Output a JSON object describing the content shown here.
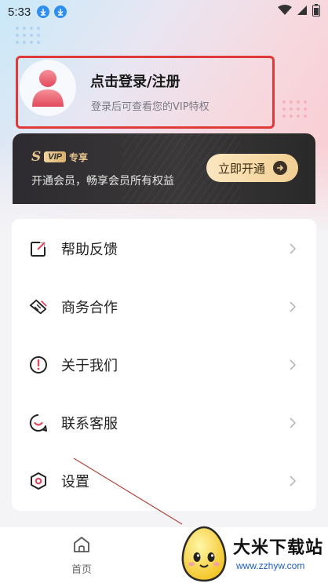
{
  "status_bar": {
    "time": "5:33",
    "icons": [
      "download-icon",
      "download-icon",
      "wifi-icon",
      "signal-icon",
      "battery-icon"
    ]
  },
  "login": {
    "title": "点击登录/注册",
    "subtitle": "登录后可查看您的VIP特权",
    "highlight_color": "#e0393a"
  },
  "vip": {
    "badge_s": "S",
    "badge_vip": "VIP",
    "badge_tag": "专享",
    "description": "开通会员，畅享会员所有权益",
    "button_label": "立即开通",
    "accent_color": "#e6c58f"
  },
  "menu": {
    "items": [
      {
        "label": "帮助反馈",
        "icon": "feedback-icon"
      },
      {
        "label": "商务合作",
        "icon": "handshake-icon"
      },
      {
        "label": "关于我们",
        "icon": "info-icon"
      },
      {
        "label": "联系客服",
        "icon": "customer-service-icon"
      },
      {
        "label": "设置",
        "icon": "settings-icon"
      }
    ]
  },
  "bottom_nav": {
    "home_label": "首页",
    "home_icon": "home-icon"
  },
  "watermark": {
    "title": "大米下载站",
    "url": "www.zzhyw.com"
  }
}
